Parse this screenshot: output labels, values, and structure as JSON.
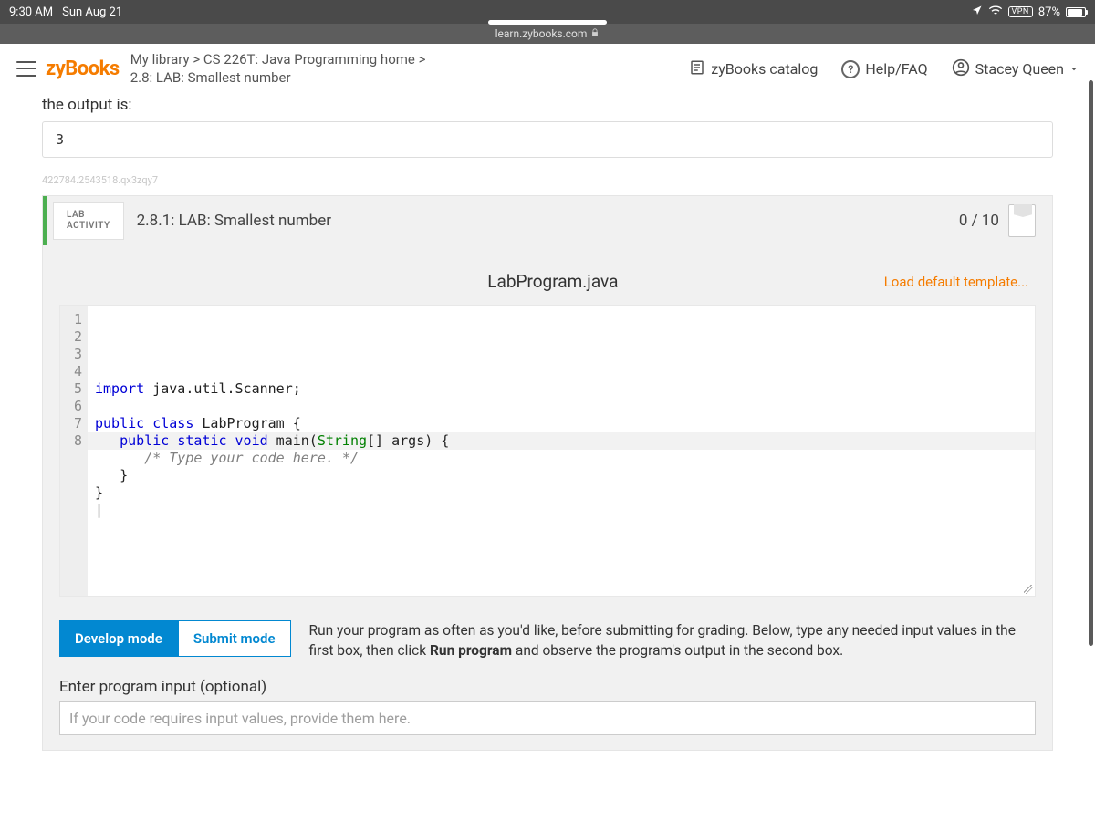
{
  "status": {
    "time": "9:30 AM",
    "date": "Sun Aug 21",
    "vpn": "VPN",
    "battery": "87%"
  },
  "urlbar": {
    "domain": "learn.zybooks.com"
  },
  "header": {
    "logo": "zyBooks",
    "breadcrumb_line1": "My library > CS 226T: Java Programming home >",
    "breadcrumb_line2": "2.8: LAB: Smallest number",
    "catalog": "zyBooks catalog",
    "help": "Help/FAQ",
    "user": "Stacey Queen"
  },
  "output": {
    "label": "the output is:",
    "value": "3"
  },
  "fingerprint": "422784.2543518.qx3zqy7",
  "activity": {
    "tag1": "LAB",
    "tag2": "ACTIVITY",
    "title": "2.8.1: LAB: Smallest number",
    "score": "0 / 10"
  },
  "editor": {
    "filename": "LabProgram.java",
    "load_link": "Load default template...",
    "lines": [
      "1",
      "2",
      "3",
      "4",
      "5",
      "6",
      "7",
      "8"
    ],
    "code": {
      "l1_a": "import",
      "l1_b": " java.util.Scanner;",
      "l3_a": "public",
      "l3_b": "class",
      "l3_c": " LabProgram {",
      "l4_a": "public",
      "l4_b": "static",
      "l4_c": "void",
      "l4_d": " main(",
      "l4_e": "String",
      "l4_f": "[] args) {",
      "l5": "/* Type your code here. */",
      "l6": "   }",
      "l7": "}"
    }
  },
  "modes": {
    "develop": "Develop mode",
    "submit": "Submit mode",
    "instructions_a": "Run your program as often as you'd like, before submitting for grading. Below, type any needed input values in the first box, then click ",
    "instructions_b": "Run program",
    "instructions_c": " and observe the program's output in the second box."
  },
  "input": {
    "label": "Enter program input (optional)",
    "placeholder": "If your code requires input values, provide them here."
  }
}
